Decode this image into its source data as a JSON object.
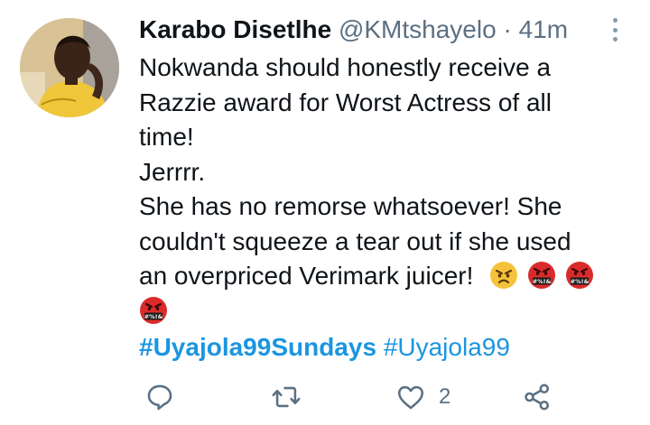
{
  "tweet": {
    "author_name": "Karabo Disetlhe",
    "handle": "@KMtshayelo",
    "separator": "·",
    "time": "41m",
    "lines": [
      "Nokwanda should honestly receive a",
      "Razzie award for Worst Actress of all",
      "time!",
      "Jerrrr.",
      "She has no remorse whatsoever! She",
      "couldn't squeeze a tear out if she used",
      "an overpriced Verimark juicer!"
    ],
    "emojis": [
      "angry-face",
      "face-with-symbols-on-mouth",
      "face-with-symbols-on-mouth",
      "face-with-symbols-on-mouth"
    ],
    "emoji_symbol_text": "#%!&",
    "hashtags": [
      "#Uyajola99Sundays",
      "#Uyajola99"
    ],
    "like_count": "2"
  },
  "icons": {
    "reply": "reply-icon",
    "retweet": "retweet-icon",
    "like": "heart-icon",
    "share": "share-icon",
    "more": "more-vertical-icon"
  },
  "colors": {
    "text": "#0f1419",
    "secondary": "#5b7083",
    "hashtag": "#1b95e0",
    "emoji_red": "#d92b2b",
    "emoji_yellow": "#f5c33b"
  }
}
